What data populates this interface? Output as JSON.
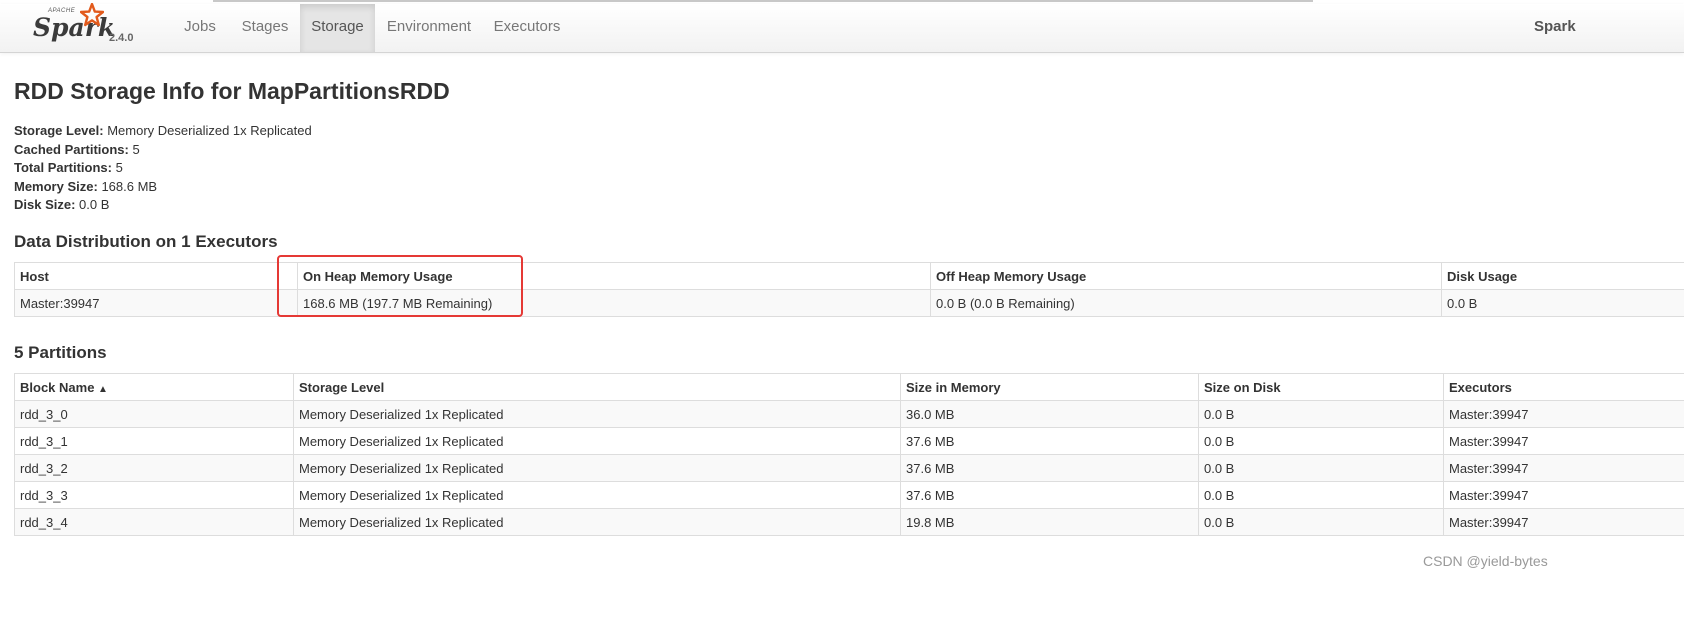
{
  "navbar": {
    "logo_small_text": "APACHE",
    "logo_text": "Spark",
    "version": "2.4.0",
    "tabs": [
      {
        "label": "Jobs"
      },
      {
        "label": "Stages"
      },
      {
        "label": "Storage",
        "active": true
      },
      {
        "label": "Environment"
      },
      {
        "label": "Executors"
      }
    ],
    "app_name": "Spark"
  },
  "page_title": "RDD Storage Info for MapPartitionsRDD",
  "summary": [
    {
      "label": "Storage Level:",
      "value": "Memory Deserialized 1x Replicated"
    },
    {
      "label": "Cached Partitions:",
      "value": "5"
    },
    {
      "label": "Total Partitions:",
      "value": "5"
    },
    {
      "label": "Memory Size:",
      "value": "168.6 MB"
    },
    {
      "label": "Disk Size:",
      "value": "0.0 B"
    }
  ],
  "distribution": {
    "heading": "Data Distribution on 1 Executors",
    "columns": [
      "Host",
      "On Heap Memory Usage",
      "Off Heap Memory Usage",
      "Disk Usage"
    ],
    "rows": [
      [
        "Master:39947",
        "168.6 MB (197.7 MB Remaining)",
        "0.0 B (0.0 B Remaining)",
        "0.0 B"
      ]
    ]
  },
  "partitions": {
    "heading": "5 Partitions",
    "columns": [
      "Block Name",
      "Storage Level",
      "Size in Memory",
      "Size on Disk",
      "Executors"
    ],
    "sort_indicator": "▲",
    "rows": [
      [
        "rdd_3_0",
        "Memory Deserialized 1x Replicated",
        "36.0 MB",
        "0.0 B",
        "Master:39947"
      ],
      [
        "rdd_3_1",
        "Memory Deserialized 1x Replicated",
        "37.6 MB",
        "0.0 B",
        "Master:39947"
      ],
      [
        "rdd_3_2",
        "Memory Deserialized 1x Replicated",
        "37.6 MB",
        "0.0 B",
        "Master:39947"
      ],
      [
        "rdd_3_3",
        "Memory Deserialized 1x Replicated",
        "37.6 MB",
        "0.0 B",
        "Master:39947"
      ],
      [
        "rdd_3_4",
        "Memory Deserialized 1x Replicated",
        "19.8 MB",
        "0.0 B",
        "Master:39947"
      ]
    ]
  },
  "watermark": "CSDN @yield-bytes",
  "colors": {
    "highlight_border": "#e53935",
    "logo_star": "#e25a1c",
    "nav_active_bg": "#e5e5e5"
  }
}
